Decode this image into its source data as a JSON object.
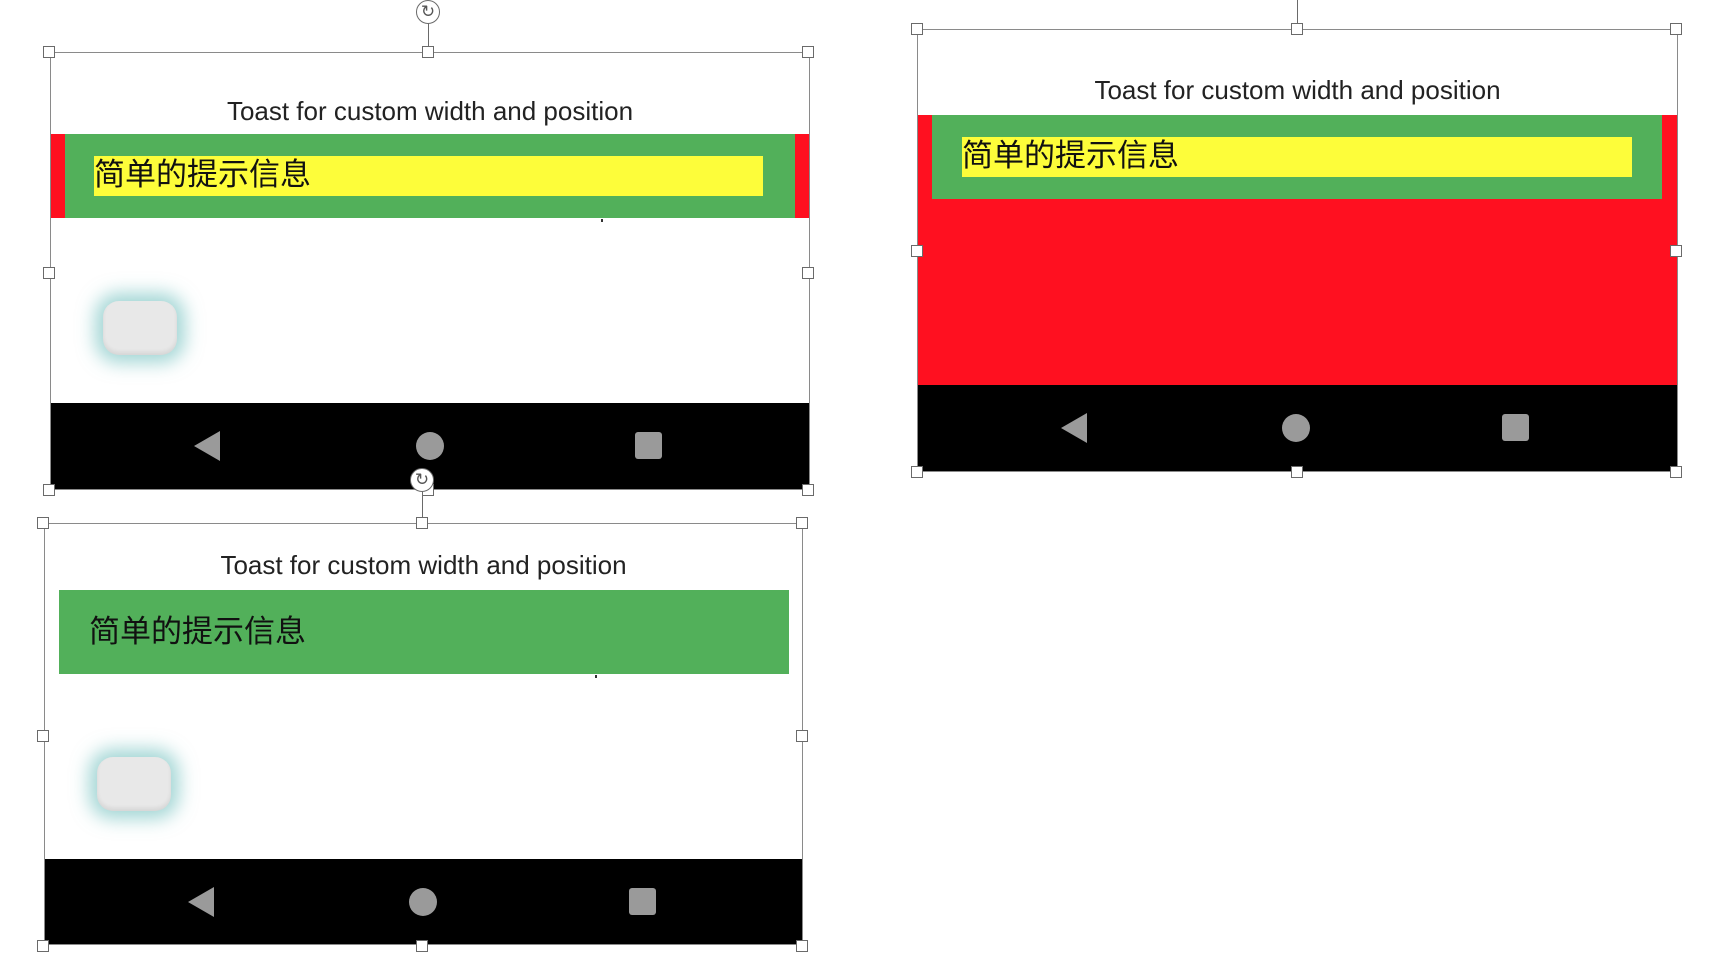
{
  "colors": {
    "toast_green": "#52b05a",
    "toast_yellow": "#fdfd3a",
    "toast_red": "#ff1020",
    "navbar_black": "#000000",
    "nav_icon_gray": "#9a9a9a",
    "fab_glow_teal": "#58b4b2"
  },
  "screens": [
    {
      "title": "Toast for custom width and position",
      "toast_text": "简单的提示信息",
      "toast_style": "red edges, green body, yellow text background",
      "navbar": [
        "back-icon",
        "home-icon",
        "recent-apps-icon"
      ]
    },
    {
      "title": "Toast for custom width and position",
      "toast_text": "简单的提示信息",
      "toast_style": "full red container, green body, yellow text background",
      "navbar": [
        "back-icon",
        "home-icon",
        "recent-apps-icon"
      ]
    },
    {
      "title": "Toast for custom width and position",
      "toast_text": "简单的提示信息",
      "toast_style": "green body only",
      "navbar": [
        "back-icon",
        "home-icon",
        "recent-apps-icon"
      ]
    }
  ]
}
